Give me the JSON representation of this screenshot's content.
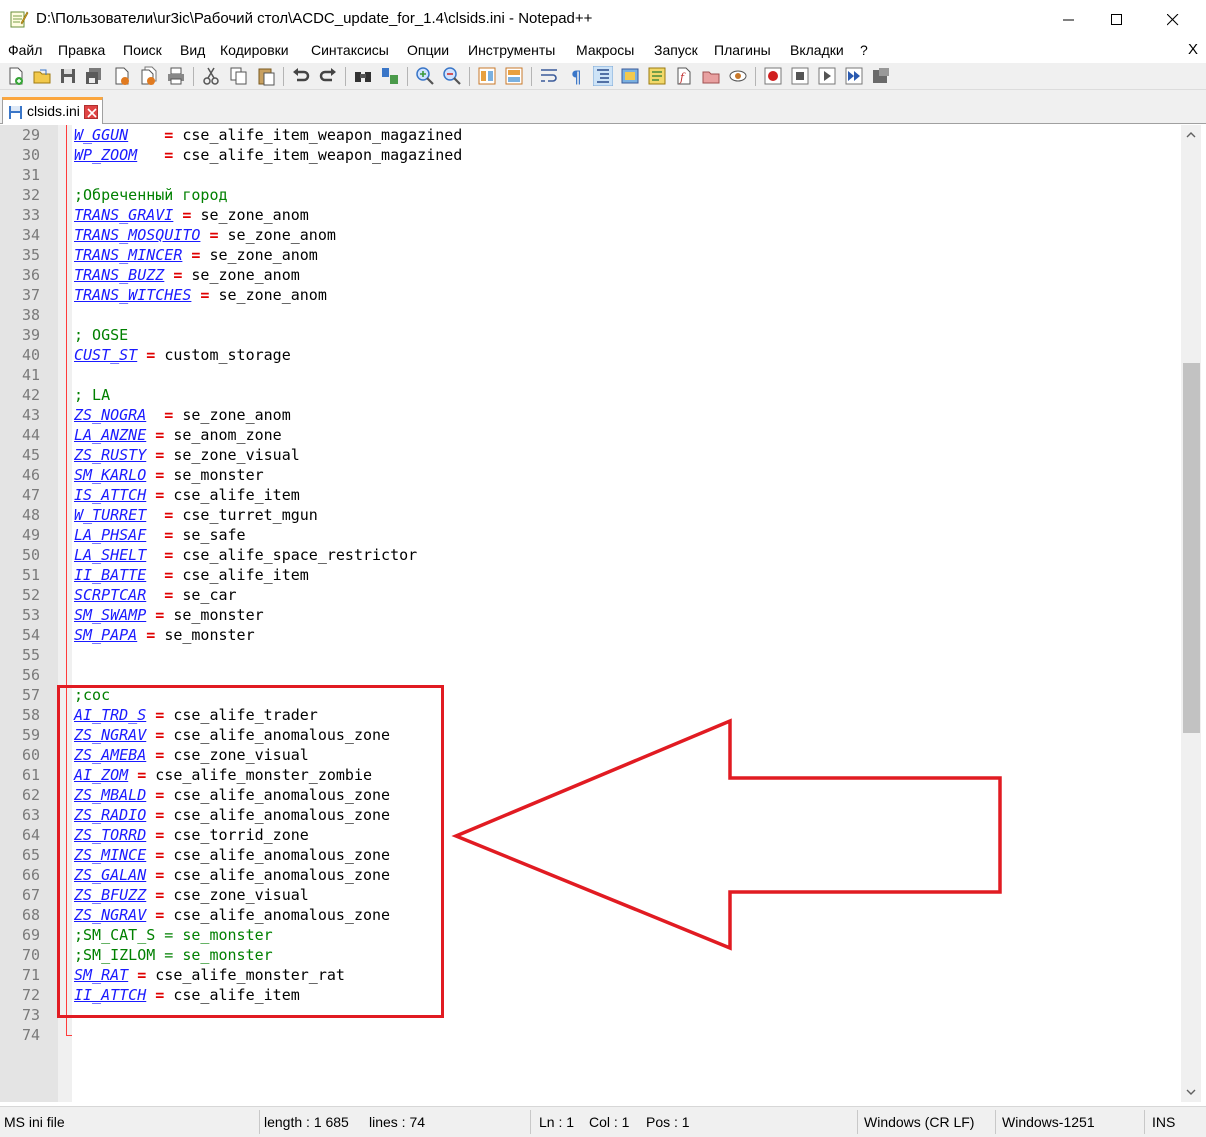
{
  "window": {
    "title": "D:\\Пользователи\\ur3ic\\Рабочий стол\\ACDC_update_for_1.4\\clsids.ini - Notepad++"
  },
  "menu": {
    "items": [
      "Файл",
      "Правка",
      "Поиск",
      "Вид",
      "Кодировки",
      "Синтаксисы",
      "Опции",
      "Инструменты",
      "Макросы",
      "Запуск",
      "Плагины",
      "Вкладки",
      "?"
    ],
    "close_doc": "X"
  },
  "tab": {
    "label": "clsids.ini"
  },
  "editor": {
    "lines": [
      {
        "n": "29",
        "key": "W_GGUN",
        "eq": "    = ",
        "val": "cse_alife_item_weapon_magazined"
      },
      {
        "n": "30",
        "key": "WP_ZOOM",
        "eq": "   = ",
        "val": "cse_alife_item_weapon_magazined"
      },
      {
        "n": "31"
      },
      {
        "n": "32",
        "comment": ";Обреченный город"
      },
      {
        "n": "33",
        "key": "TRANS_GRAVI",
        "eq": " = ",
        "val": "se_zone_anom"
      },
      {
        "n": "34",
        "key": "TRANS_MOSQUITO",
        "eq": " = ",
        "val": "se_zone_anom"
      },
      {
        "n": "35",
        "key": "TRANS_MINCER",
        "eq": " = ",
        "val": "se_zone_anom"
      },
      {
        "n": "36",
        "key": "TRANS_BUZZ",
        "eq": " = ",
        "val": "se_zone_anom"
      },
      {
        "n": "37",
        "key": "TRANS_WITCHES",
        "eq": " = ",
        "val": "se_zone_anom"
      },
      {
        "n": "38"
      },
      {
        "n": "39",
        "comment": "; OGSE"
      },
      {
        "n": "40",
        "key": "CUST_ST",
        "eq": " = ",
        "val": "custom_storage"
      },
      {
        "n": "41"
      },
      {
        "n": "42",
        "comment": "; LA"
      },
      {
        "n": "43",
        "key": "ZS_NOGRA",
        "eq": "  = ",
        "val": "se_zone_anom"
      },
      {
        "n": "44",
        "key": "LA_ANZNE",
        "eq": " = ",
        "val": "se_anom_zone"
      },
      {
        "n": "45",
        "key": "ZS_RUSTY",
        "eq": " = ",
        "val": "se_zone_visual"
      },
      {
        "n": "46",
        "key": "SM_KARLO",
        "eq": " = ",
        "val": "se_monster"
      },
      {
        "n": "47",
        "key": "IS_ATTCH",
        "eq": " = ",
        "val": "cse_alife_item"
      },
      {
        "n": "48",
        "key": "W_TURRET",
        "eq": "  = ",
        "val": "cse_turret_mgun"
      },
      {
        "n": "49",
        "key": "LA_PHSAF",
        "eq": "  = ",
        "val": "se_safe"
      },
      {
        "n": "50",
        "key": "LA_SHELT",
        "eq": "  = ",
        "val": "cse_alife_space_restrictor"
      },
      {
        "n": "51",
        "key": "II_BATTE",
        "eq": "  = ",
        "val": "cse_alife_item"
      },
      {
        "n": "52",
        "key": "SCRPTCAR",
        "eq": "  = ",
        "val": "se_car"
      },
      {
        "n": "53",
        "key": "SM_SWAMP",
        "eq": " = ",
        "val": "se_monster"
      },
      {
        "n": "54",
        "key": "SM_PAPA",
        "eq": " = ",
        "val": "se_monster"
      },
      {
        "n": "55"
      },
      {
        "n": "56"
      },
      {
        "n": "57",
        "comment": ";coc"
      },
      {
        "n": "58",
        "key": "AI_TRD_S",
        "eq": " = ",
        "val": "cse_alife_trader"
      },
      {
        "n": "59",
        "key": "ZS_NGRAV",
        "eq": " = ",
        "val": "cse_alife_anomalous_zone"
      },
      {
        "n": "60",
        "key": "ZS_AMEBA",
        "eq": " = ",
        "val": "cse_zone_visual"
      },
      {
        "n": "61",
        "key": "AI_ZOM",
        "eq": " = ",
        "val": "cse_alife_monster_zombie"
      },
      {
        "n": "62",
        "key": "ZS_MBALD",
        "eq": " = ",
        "val": "cse_alife_anomalous_zone"
      },
      {
        "n": "63",
        "key": "ZS_RADIO",
        "eq": " = ",
        "val": "cse_alife_anomalous_zone"
      },
      {
        "n": "64",
        "key": "ZS_TORRD",
        "eq": " = ",
        "val": "cse_torrid_zone"
      },
      {
        "n": "65",
        "key": "ZS_MINCE",
        "eq": " = ",
        "val": "cse_alife_anomalous_zone"
      },
      {
        "n": "66",
        "key": "ZS_GALAN",
        "eq": " = ",
        "val": "cse_alife_anomalous_zone"
      },
      {
        "n": "67",
        "key": "ZS_BFUZZ",
        "eq": " = ",
        "val": "cse_zone_visual"
      },
      {
        "n": "68",
        "key": "ZS_NGRAV",
        "eq": " = ",
        "val": "cse_alife_anomalous_zone"
      },
      {
        "n": "69",
        "comment": ";SM_CAT_S = se_monster"
      },
      {
        "n": "70",
        "comment": ";SM_IZLOM = se_monster"
      },
      {
        "n": "71",
        "key": "SM_RAT",
        "eq": " = ",
        "val": "cse_alife_monster_rat"
      },
      {
        "n": "72",
        "key": "II_ATTCH",
        "eq": " = ",
        "val": "cse_alife_item"
      },
      {
        "n": "73"
      },
      {
        "n": "74"
      }
    ]
  },
  "status": {
    "filetype": "MS ini file",
    "length": "length : 1 685",
    "lines": "lines : 74",
    "ln": "Ln : 1",
    "col": "Col : 1",
    "pos": "Pos : 1",
    "eol": "Windows (CR LF)",
    "encoding": "Windows-1251",
    "mode": "INS"
  },
  "colors": {
    "keyword": "#1a1aff",
    "operator": "#e00000",
    "comment": "#008000",
    "annotation": "#e11b22"
  }
}
